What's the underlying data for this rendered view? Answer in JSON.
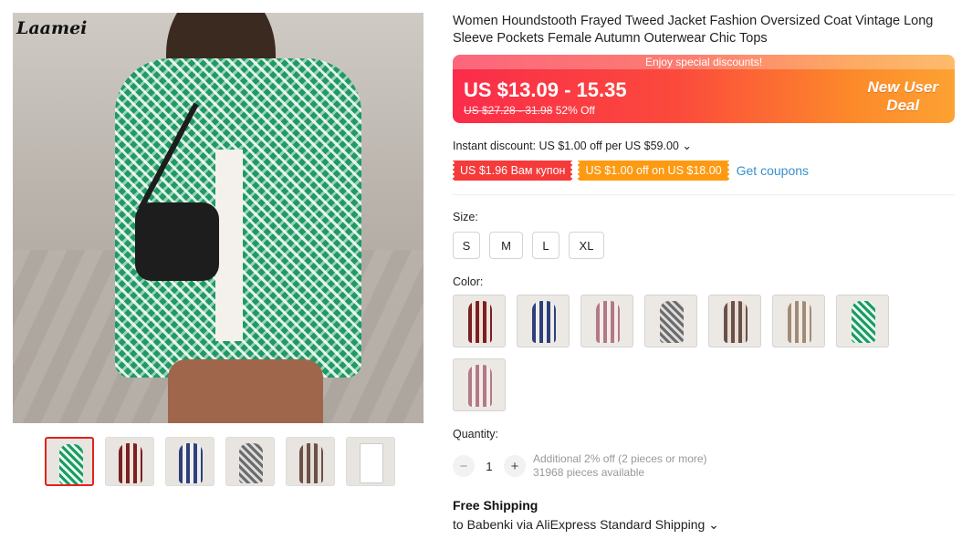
{
  "gallery": {
    "logo_text": "Laamei",
    "thumbnails": [
      {
        "name": "thumb-green-houndstooth",
        "style": "green",
        "active": true
      },
      {
        "name": "thumb-red-plaid",
        "style": "plaid-red",
        "active": false
      },
      {
        "name": "thumb-blue-plaid",
        "style": "plaid-blue",
        "active": false
      },
      {
        "name": "thumb-grey",
        "style": "grey",
        "active": false
      },
      {
        "name": "thumb-brown",
        "style": "brown",
        "active": false
      },
      {
        "name": "thumb-size-chart",
        "style": "chart",
        "active": false
      }
    ]
  },
  "product": {
    "title": "Women Houndstooth Frayed Tweed Jacket Fashion Oversized Coat Vintage Long Sleeve Pockets Female Autumn Outerwear Chic Tops"
  },
  "price_banner": {
    "strip_text": "Enjoy special discounts!",
    "price": "US $13.09 - 15.35",
    "original_price": "US $27.28 - 31.98",
    "discount": "52% Off",
    "new_user_line1": "New User",
    "new_user_line2": "Deal",
    "colors": {
      "start": "#fb2c4a",
      "end": "#fda233"
    }
  },
  "instant_discount": {
    "text": "Instant discount: US $1.00 off per US $59.00",
    "chevron": "⌄"
  },
  "coupons": [
    {
      "text": "US $1.96 Вам купон",
      "color": "#f53a3a"
    },
    {
      "text": "US $1.00 off on US $18.00",
      "color": "#fd9a12"
    }
  ],
  "get_coupons_label": "Get coupons",
  "size": {
    "label": "Size:",
    "options": [
      "S",
      "M",
      "L",
      "XL"
    ]
  },
  "color": {
    "label": "Color:",
    "options": [
      "plaid-red",
      "plaid-blue",
      "pink",
      "grey",
      "brown",
      "khaki",
      "green",
      "pink"
    ]
  },
  "quantity": {
    "label": "Quantity:",
    "minus": "−",
    "value": "1",
    "plus": "+",
    "note_line1": "Additional 2% off (2 pieces or more)",
    "note_line2": "31968 pieces available"
  },
  "shipping": {
    "title": "Free Shipping",
    "detail": "to Babenki via AliExpress Standard Shipping",
    "chevron": "⌄"
  },
  "accent_color": "#e2231a",
  "link_color": "#3a8fd0"
}
